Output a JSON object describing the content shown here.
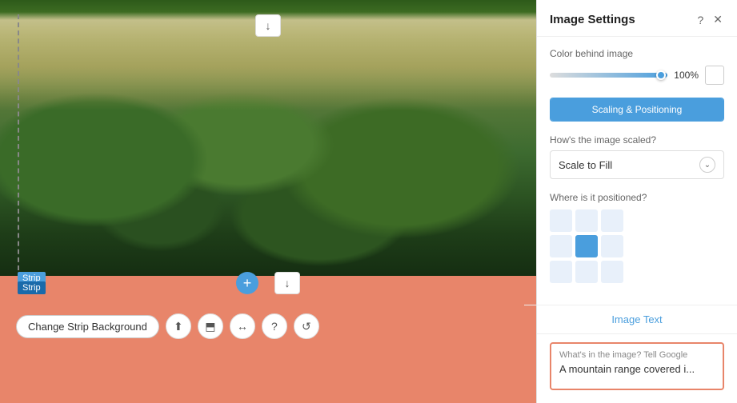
{
  "canvas": {
    "top_download_title": "↓",
    "mid_download_title": "↓",
    "add_btn_label": "+",
    "strip_label_top": "Strip",
    "strip_label_bottom": "Strip"
  },
  "toolbar": {
    "change_bg_label": "Change Strip Background",
    "icon1": "⬆",
    "icon2": "⬒",
    "icon3": "↔",
    "icon4": "?",
    "icon5": "↺"
  },
  "panel": {
    "title": "Image Settings",
    "help_icon": "?",
    "close_icon": "✕",
    "color_section_label": "Color behind image",
    "opacity_pct": "100%",
    "scaling_tab_label": "Scaling & Positioning",
    "how_scaled_label": "How's the image scaled?",
    "scale_value": "Scale to Fill",
    "where_positioned_label": "Where is it positioned?",
    "image_text_tab": "Image Text",
    "image_text_prompt": "What's in the image? Tell Google",
    "image_text_value": "A mountain range covered i..."
  }
}
